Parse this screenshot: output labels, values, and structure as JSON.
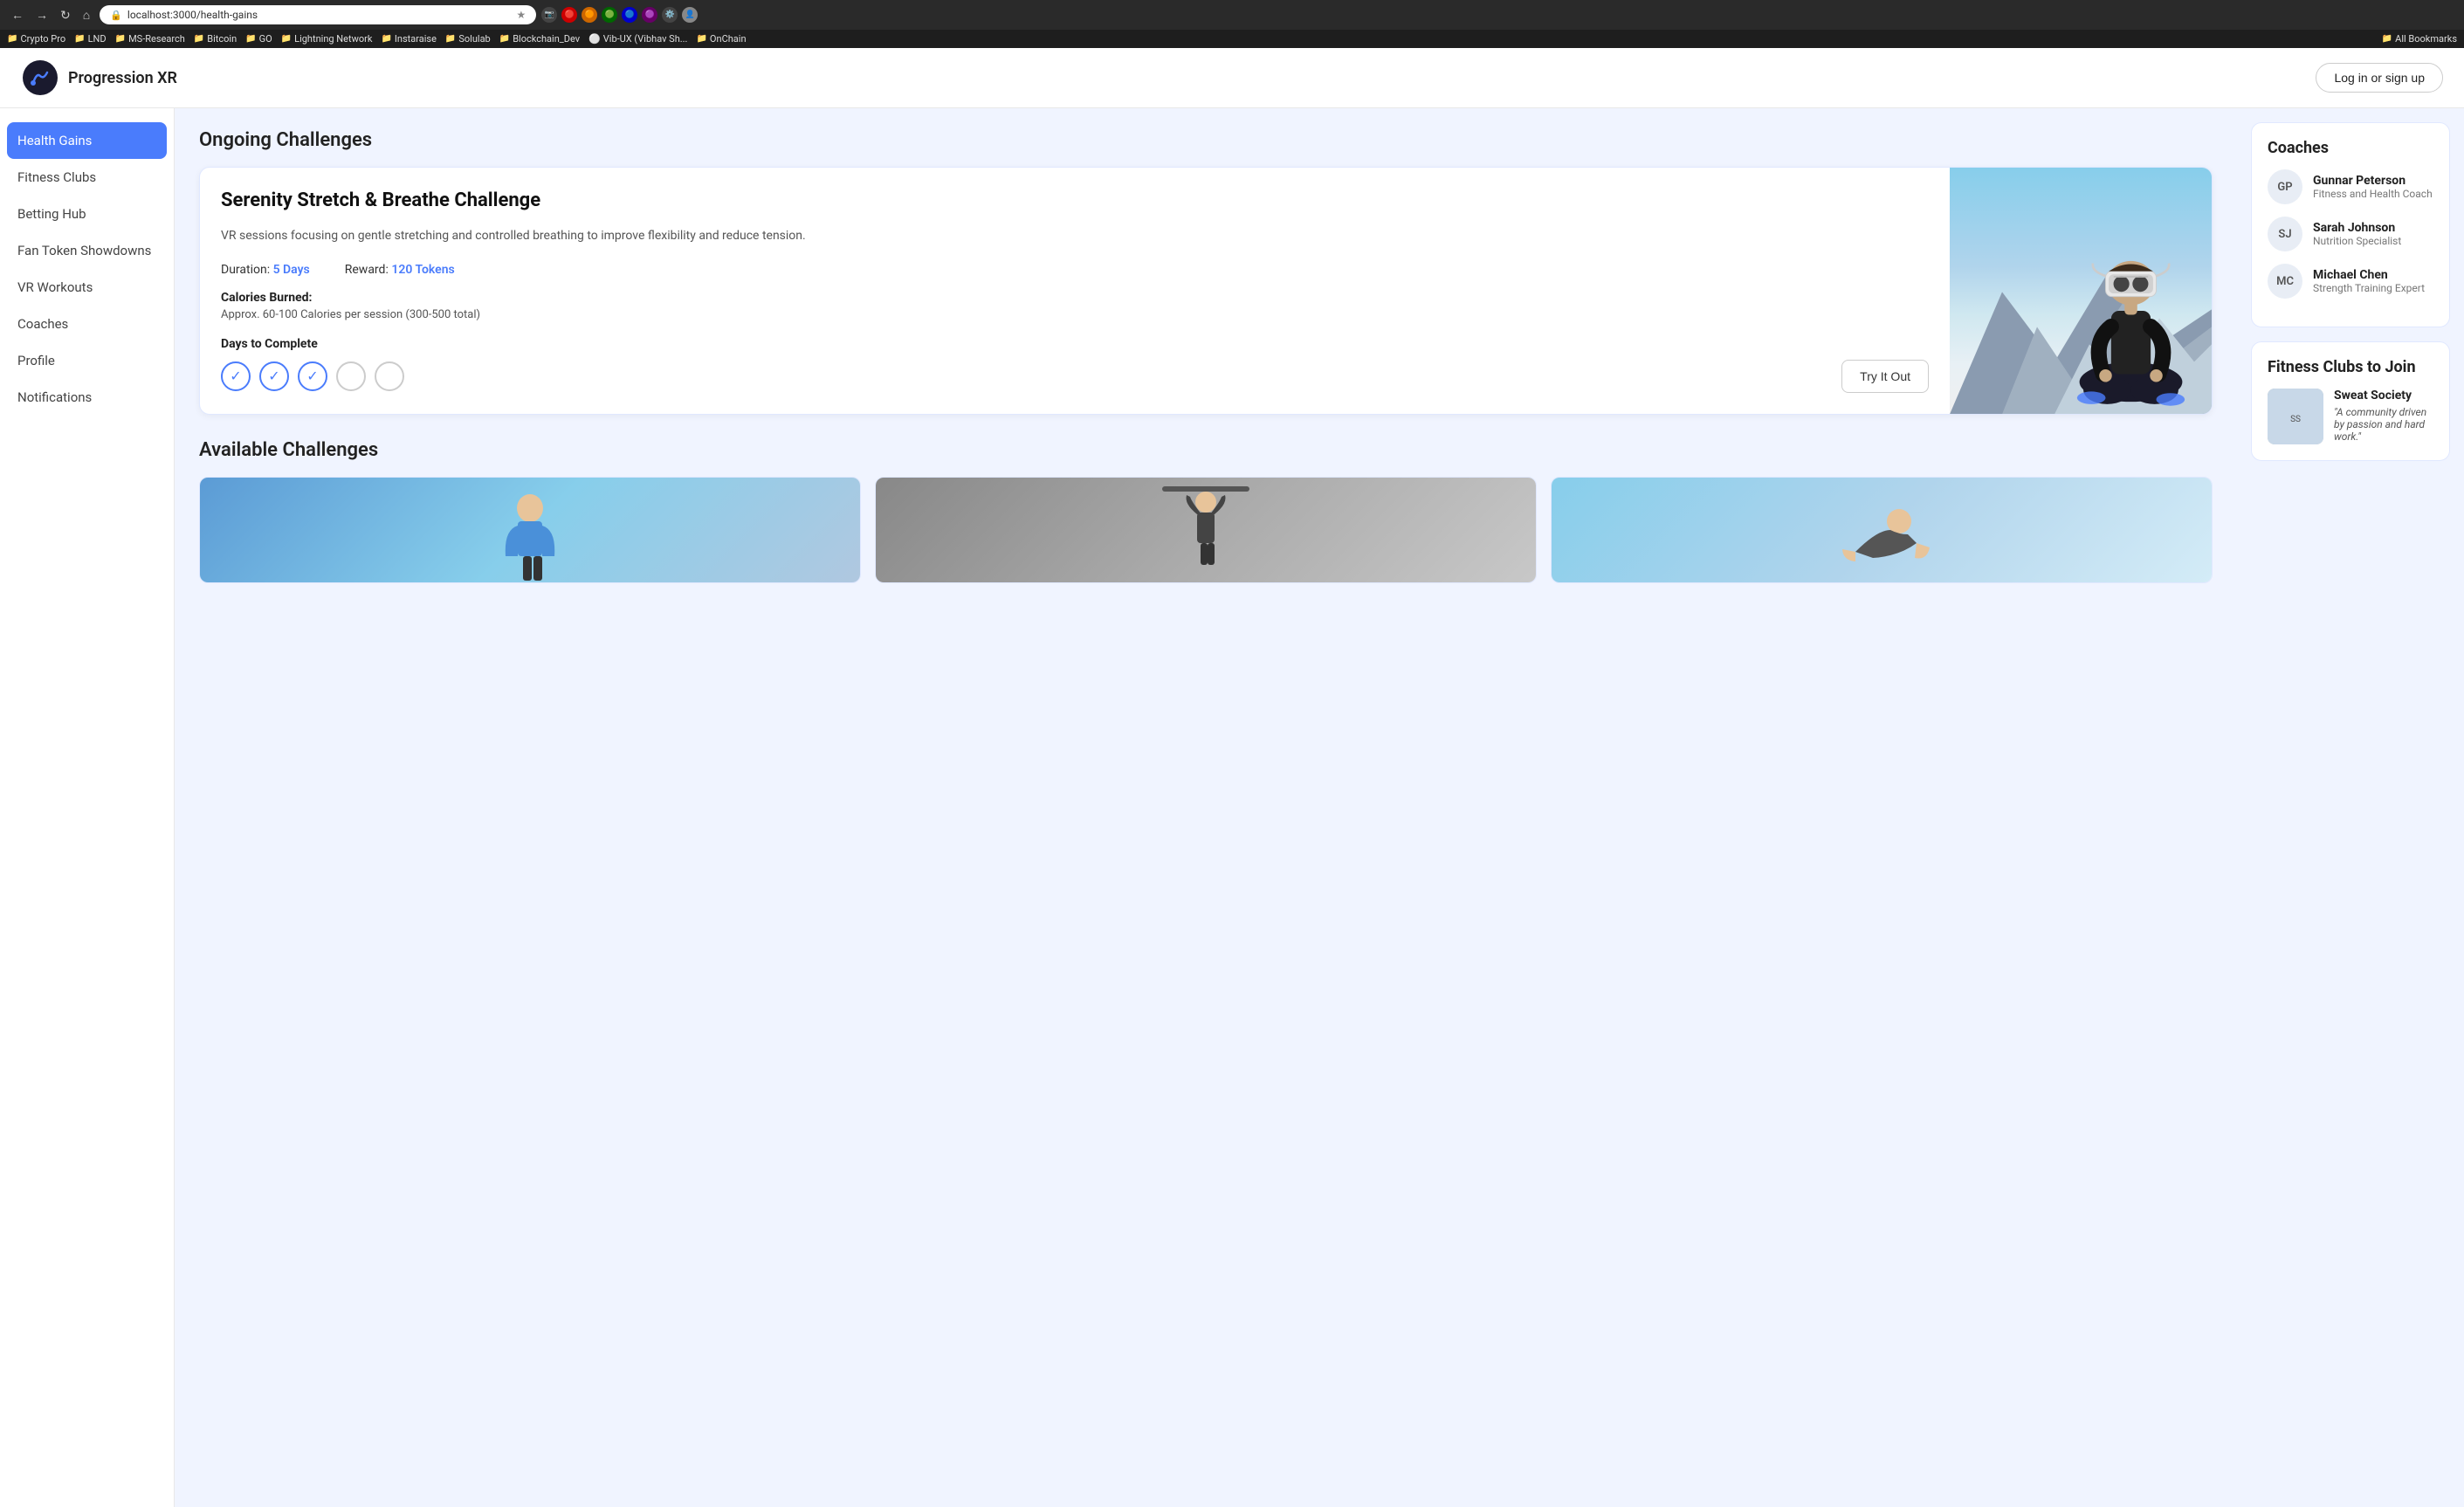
{
  "browser": {
    "url": "localhost:3000/health-gains",
    "nav_back": "←",
    "nav_forward": "→",
    "nav_reload": "↻",
    "nav_home": "⌂",
    "bookmarks": [
      {
        "label": "Crypto Pro",
        "icon": "📁"
      },
      {
        "label": "LND",
        "icon": "📁"
      },
      {
        "label": "MS-Research",
        "icon": "📁"
      },
      {
        "label": "Bitcoin",
        "icon": "📁"
      },
      {
        "label": "GO",
        "icon": "📁"
      },
      {
        "label": "Lightning Network",
        "icon": "📁"
      },
      {
        "label": "Instaraise",
        "icon": "📁"
      },
      {
        "label": "Solulab",
        "icon": "📁"
      },
      {
        "label": "Blockchain_Dev",
        "icon": "📁"
      },
      {
        "label": "Vib-UX (Vibhav Sh...",
        "icon": "⚪"
      },
      {
        "label": "OnChain",
        "icon": "📁"
      },
      {
        "label": "All Bookmarks",
        "icon": "📁"
      }
    ]
  },
  "header": {
    "logo_text": "Progression XR",
    "login_label": "Log in or sign up"
  },
  "sidebar": {
    "items": [
      {
        "label": "Health Gains",
        "active": true
      },
      {
        "label": "Fitness Clubs",
        "active": false
      },
      {
        "label": "Betting Hub",
        "active": false
      },
      {
        "label": "Fan Token Showdowns",
        "active": false
      },
      {
        "label": "VR Workouts",
        "active": false
      },
      {
        "label": "Coaches",
        "active": false
      },
      {
        "label": "Profile",
        "active": false
      },
      {
        "label": "Notifications",
        "active": false
      }
    ]
  },
  "main": {
    "ongoing_title": "Ongoing Challenges",
    "challenge": {
      "title": "Serenity Stretch & Breathe Challenge",
      "description": "VR sessions focusing on gentle stretching and controlled breathing to improve flexibility and reduce tension.",
      "duration_label": "Duration:",
      "duration_value": "5 Days",
      "reward_label": "Reward:",
      "reward_value": "120 Tokens",
      "calories_title": "Calories Burned:",
      "calories_text": "Approx. 60-100 Calories per session (300-500 total)",
      "days_title": "Days to Complete",
      "days": [
        {
          "completed": true
        },
        {
          "completed": true
        },
        {
          "completed": true
        },
        {
          "completed": false
        },
        {
          "completed": false
        }
      ],
      "try_button": "Try It Out"
    },
    "available_title": "Available Challenges",
    "available_cards": [
      {
        "theme": "blue"
      },
      {
        "theme": "gray"
      },
      {
        "theme": "sky"
      }
    ]
  },
  "right_sidebar": {
    "coaches_title": "Coaches",
    "coaches": [
      {
        "initials": "GP",
        "name": "Gunnar Peterson",
        "role": "Fitness and Health Coach"
      },
      {
        "initials": "SJ",
        "name": "Sarah Johnson",
        "role": "Nutrition Specialist"
      },
      {
        "initials": "MC",
        "name": "Michael Chen",
        "role": "Strength Training Expert"
      }
    ],
    "clubs_title": "Fitness Clubs to Join",
    "clubs": [
      {
        "name": "Sweat Society",
        "quote": "\"A community driven by passion and hard work.\""
      }
    ]
  }
}
